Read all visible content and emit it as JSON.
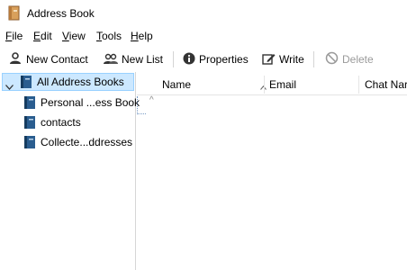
{
  "window": {
    "title": "Address Book"
  },
  "menu": {
    "items": [
      {
        "acc": "F",
        "rest": "ile"
      },
      {
        "acc": "E",
        "rest": "dit"
      },
      {
        "acc": "V",
        "rest": "iew"
      },
      {
        "acc": "T",
        "rest": "ools"
      },
      {
        "acc": "H",
        "rest": "elp"
      }
    ]
  },
  "toolbar": {
    "new_contact": "New Contact",
    "new_list": "New List",
    "properties": "Properties",
    "write": "Write",
    "delete": "Delete"
  },
  "tree": {
    "root": "All Address Books",
    "children": [
      "Personal ...ess Book",
      "contacts",
      "Collecte...ddresses"
    ]
  },
  "table": {
    "columns": [
      "Name",
      "Email",
      "Chat Nar"
    ],
    "sort_indicator": "^"
  },
  "colors": {
    "selection_bg": "#cce8ff",
    "selection_border": "#99d1ff",
    "book_blue": "#2a5d8f",
    "disabled_text": "#9a9a9a"
  }
}
